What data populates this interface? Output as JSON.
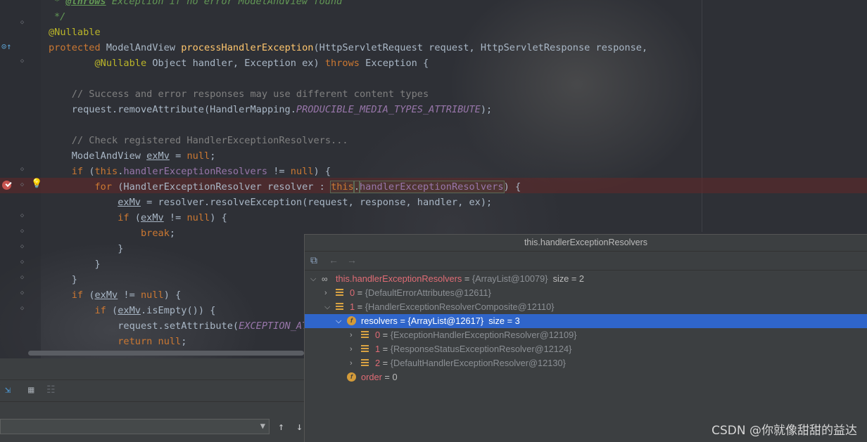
{
  "editor": {
    "lines": [
      {
        "parts": [
          [
            "doc",
            "* "
          ],
          [
            "docb",
            "@throws"
          ],
          [
            "doc",
            " Exception if no error ModelAndView found"
          ]
        ]
      },
      {
        "parts": [
          [
            "doc",
            "*/"
          ]
        ]
      },
      {
        "parts": [
          [
            "ann",
            "@Nullable"
          ]
        ]
      },
      {
        "parts": [
          [
            "kw",
            "protected "
          ],
          [
            "txt",
            "ModelAndView "
          ],
          [
            "fn",
            "processHandlerException"
          ],
          [
            "txt",
            "(HttpServletRequest request, HttpServletResponse response,"
          ]
        ]
      },
      {
        "parts": [
          [
            "txt",
            "        "
          ],
          [
            "ann",
            "@Nullable "
          ],
          [
            "txt",
            "Object handler, Exception ex) "
          ],
          [
            "kw",
            "throws "
          ],
          [
            "txt",
            "Exception {"
          ]
        ]
      },
      {
        "parts": []
      },
      {
        "parts": [
          [
            "cm",
            "    // Success and error responses may use different content types"
          ]
        ]
      },
      {
        "parts": [
          [
            "txt",
            "    request.removeAttribute(HandlerMapping."
          ],
          [
            "cst",
            "PRODUCIBLE_MEDIA_TYPES_ATTRIBUTE"
          ],
          [
            "txt",
            ");"
          ]
        ]
      },
      {
        "parts": []
      },
      {
        "parts": [
          [
            "cm",
            "    // Check registered HandlerExceptionResolvers..."
          ]
        ]
      },
      {
        "parts": [
          [
            "txt",
            "    ModelAndView "
          ],
          [
            "ul",
            "exMv"
          ],
          [
            "txt",
            " = "
          ],
          [
            "kw",
            "null"
          ],
          [
            "txt",
            ";"
          ]
        ]
      },
      {
        "parts": [
          [
            "txt",
            "    "
          ],
          [
            "kw",
            "if "
          ],
          [
            "txt",
            "("
          ],
          [
            "kw",
            "this"
          ],
          [
            "txt",
            "."
          ],
          [
            "fld",
            "handlerExceptionResolvers"
          ],
          [
            "txt",
            " != "
          ],
          [
            "kw",
            "null"
          ],
          [
            "txt",
            ") {"
          ]
        ]
      },
      {
        "parts": [
          [
            "txt",
            "        "
          ],
          [
            "kw",
            "for "
          ],
          [
            "txt",
            "(HandlerExceptionResolver resolver : "
          ],
          [
            "boxedkw",
            "this"
          ],
          [
            "boxed",
            "."
          ],
          [
            "boxedfld",
            "handlerExceptionResolvers"
          ],
          [
            "txt",
            ") {"
          ]
        ]
      },
      {
        "parts": [
          [
            "txt",
            "            "
          ],
          [
            "ul",
            "exMv"
          ],
          [
            "txt",
            " = resolver.resolveException(request, response, handler, ex);"
          ]
        ]
      },
      {
        "parts": [
          [
            "txt",
            "            "
          ],
          [
            "kw",
            "if "
          ],
          [
            "txt",
            "("
          ],
          [
            "ul",
            "exMv"
          ],
          [
            "txt",
            " != "
          ],
          [
            "kw",
            "null"
          ],
          [
            "txt",
            ") {"
          ]
        ]
      },
      {
        "parts": [
          [
            "txt",
            "                "
          ],
          [
            "kw",
            "break"
          ],
          [
            "txt",
            ";"
          ]
        ]
      },
      {
        "parts": [
          [
            "txt",
            "            }"
          ]
        ]
      },
      {
        "parts": [
          [
            "txt",
            "        }"
          ]
        ]
      },
      {
        "parts": [
          [
            "txt",
            "    }"
          ]
        ]
      },
      {
        "parts": [
          [
            "txt",
            "    "
          ],
          [
            "kw",
            "if "
          ],
          [
            "txt",
            "("
          ],
          [
            "ul",
            "exMv"
          ],
          [
            "txt",
            " != "
          ],
          [
            "kw",
            "null"
          ],
          [
            "txt",
            ") {"
          ]
        ]
      },
      {
        "parts": [
          [
            "txt",
            "        "
          ],
          [
            "kw",
            "if "
          ],
          [
            "txt",
            "("
          ],
          [
            "ul",
            "exMv"
          ],
          [
            "txt",
            ".isEmpty()) {"
          ]
        ]
      },
      {
        "parts": [
          [
            "txt",
            "            request.setAttribute("
          ],
          [
            "cst",
            "EXCEPTION_AT"
          ]
        ]
      },
      {
        "parts": [
          [
            "txt",
            "            "
          ],
          [
            "kw",
            "return null"
          ],
          [
            "txt",
            ";"
          ]
        ]
      }
    ]
  },
  "popup": {
    "title": "this.handlerExceptionResolvers",
    "rows": [
      {
        "expanded": true,
        "icon": "watch-glasses-icon",
        "name": "this.handlerExceptionResolvers",
        "val": "{ArrayList@10079}",
        "extra": "size = 2"
      },
      {
        "expanded": false,
        "icon": "list-icon",
        "name": "0",
        "val": "{DefaultErrorAttributes@12611}",
        "extra": ""
      },
      {
        "expanded": true,
        "icon": "list-icon",
        "name": "1",
        "val": "{HandlerExceptionResolverComposite@12110}",
        "extra": ""
      },
      {
        "expanded": true,
        "icon": "field-icon",
        "name": "resolvers",
        "val": "{ArrayList@12617}",
        "extra": "size = 3"
      },
      {
        "expanded": false,
        "icon": "list-icon",
        "name": "0",
        "val": "{ExceptionHandlerExceptionResolver@12109}",
        "extra": ""
      },
      {
        "expanded": false,
        "icon": "list-icon",
        "name": "1",
        "val": "{ResponseStatusExceptionResolver@12124}",
        "extra": ""
      },
      {
        "expanded": false,
        "icon": "list-icon",
        "name": "2",
        "val": "{DefaultHandlerExceptionResolver@12130}",
        "extra": ""
      },
      {
        "expanded": null,
        "icon": "field-icon",
        "name": "order",
        "val": "0",
        "extra": ""
      }
    ],
    "selected_row": 3
  },
  "watermark": "CSDN @你就像甜甜的益达"
}
